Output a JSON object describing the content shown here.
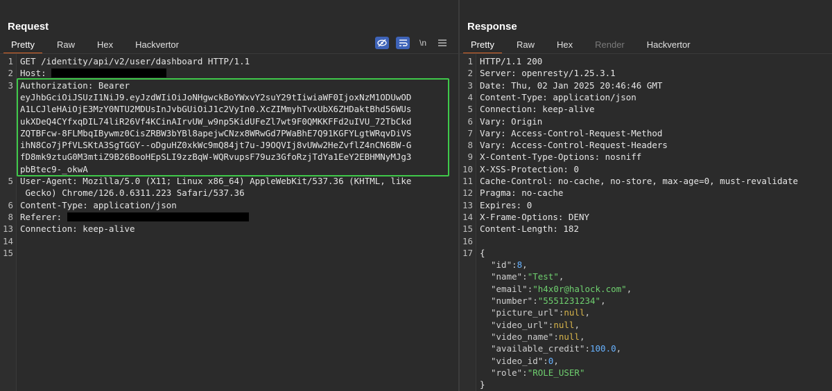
{
  "request": {
    "title": "Request",
    "tabs": [
      "Pretty",
      "Raw",
      "Hex",
      "Hackvertor"
    ],
    "active_tab": "Pretty",
    "tools": {
      "hide_icon": "eye-slash-icon",
      "wrap_icon": "wrap-lines-icon",
      "newline_label": "\\n",
      "menu_icon": "menu-icon"
    },
    "lines": [
      {
        "n": "1",
        "text": "GET /identity/api/v2/user/dashboard HTTP/1.1"
      },
      {
        "n": "2",
        "text": "Host: "
      },
      {
        "n": "3",
        "text": "Authorization: Bearer"
      },
      {
        "n": "",
        "text": "eyJhbGciOiJSUzI1NiJ9.eyJzdWIiOiJoNHgwckBoYWxvY2suY29tIiwiaWF0IjoxNzM1ODUwOD"
      },
      {
        "n": "",
        "text": "A1LCJleHAiOjE3MzY0NTU2MDUsInJvbGUiOiJ1c2VyIn0.XcZIMmyhTvxUbX6ZHDaktBhd56WUs"
      },
      {
        "n": "",
        "text": "ukXDeQ4CYfxqDIL74liR26Vf4KCinAIrvUW_w9np5KidUFeZl7wt9F0QMKKFFd2uIVU_72TbCkd"
      },
      {
        "n": "",
        "text": "ZQTBFcw-8FLMbqIBywmz0CisZRBW3bYBl8apejwCNzx8WRwGd7PWaBhE7Q91KGFYLgtWRqvDiVS"
      },
      {
        "n": "",
        "text": "ihN8Co7jPfVLSKtA3SgTGGY--oDguHZ0xkWc9mQ84jt7u-J9OQVIj8vUWw2HeZvflZ4nCN6BW-G"
      },
      {
        "n": "",
        "text": "fD8mk9ztuG0M3mtiZ9B26BooHEpSLI9zzBqW-WQRvupsF79uz3GfoRzjTdYa1EeY2EBHMNyMJg3"
      },
      {
        "n": "",
        "text": "pbBtec9-_okwA"
      },
      {
        "n": "5",
        "text": "User-Agent: Mozilla/5.0 (X11; Linux x86_64) AppleWebKit/537.36 (KHTML, like"
      },
      {
        "n": "",
        "text": " Gecko) Chrome/126.0.6311.223 Safari/537.36"
      },
      {
        "n": "6",
        "text": "Content-Type: application/json"
      },
      {
        "n": "8",
        "text": "Referer: "
      },
      {
        "n": "13",
        "text": "Connection: keep-alive"
      },
      {
        "n": "14",
        "text": ""
      },
      {
        "n": "15",
        "text": ""
      }
    ]
  },
  "response": {
    "title": "Response",
    "tabs": [
      "Pretty",
      "Raw",
      "Hex",
      "Render",
      "Hackvertor"
    ],
    "active_tab": "Pretty",
    "disabled_tab": "Render",
    "lines": [
      {
        "n": "1",
        "text": "HTTP/1.1 200"
      },
      {
        "n": "2",
        "text": "Server: openresty/1.25.3.1"
      },
      {
        "n": "3",
        "text": "Date: Thu, 02 Jan 2025 20:46:46 GMT"
      },
      {
        "n": "4",
        "text": "Content-Type: application/json"
      },
      {
        "n": "5",
        "text": "Connection: keep-alive"
      },
      {
        "n": "6",
        "text": "Vary: Origin"
      },
      {
        "n": "7",
        "text": "Vary: Access-Control-Request-Method"
      },
      {
        "n": "8",
        "text": "Vary: Access-Control-Request-Headers"
      },
      {
        "n": "9",
        "text": "X-Content-Type-Options: nosniff"
      },
      {
        "n": "10",
        "text": "X-XSS-Protection: 0"
      },
      {
        "n": "11",
        "text": "Cache-Control: no-cache, no-store, max-age=0, must-revalidate"
      },
      {
        "n": "12",
        "text": "Pragma: no-cache"
      },
      {
        "n": "13",
        "text": "Expires: 0"
      },
      {
        "n": "14",
        "text": "X-Frame-Options: DENY"
      },
      {
        "n": "15",
        "text": "Content-Length: 182"
      },
      {
        "n": "16",
        "text": ""
      },
      {
        "n": "17",
        "text": "{"
      }
    ],
    "json_body": [
      {
        "key": "\"id\"",
        "value": "8",
        "kind": "num",
        "comma": ","
      },
      {
        "key": "\"name\"",
        "value": "\"Test\"",
        "kind": "str",
        "comma": ","
      },
      {
        "key": "\"email\"",
        "value": "\"h4x0r@halock.com\"",
        "kind": "str",
        "comma": ","
      },
      {
        "key": "\"number\"",
        "value": "\"5551231234\"",
        "kind": "str",
        "comma": ","
      },
      {
        "key": "\"picture_url\"",
        "value": "null",
        "kind": "null",
        "comma": ","
      },
      {
        "key": "\"video_url\"",
        "value": "null",
        "kind": "null",
        "comma": ","
      },
      {
        "key": "\"video_name\"",
        "value": "null",
        "kind": "null",
        "comma": ","
      },
      {
        "key": "\"available_credit\"",
        "value": "100.0",
        "kind": "num",
        "comma": ","
      },
      {
        "key": "\"video_id\"",
        "value": "0",
        "kind": "num",
        "comma": ","
      },
      {
        "key": "\"role\"",
        "value": "\"ROLE_USER\"",
        "kind": "str",
        "comma": ""
      }
    ],
    "closing_brace": "}"
  },
  "colors": {
    "accent_tab": "#e26a2c",
    "highlight_box": "#3fc94a",
    "json_string": "#6fd06f",
    "json_number": "#67b2ff",
    "json_null": "#d7b44a"
  }
}
